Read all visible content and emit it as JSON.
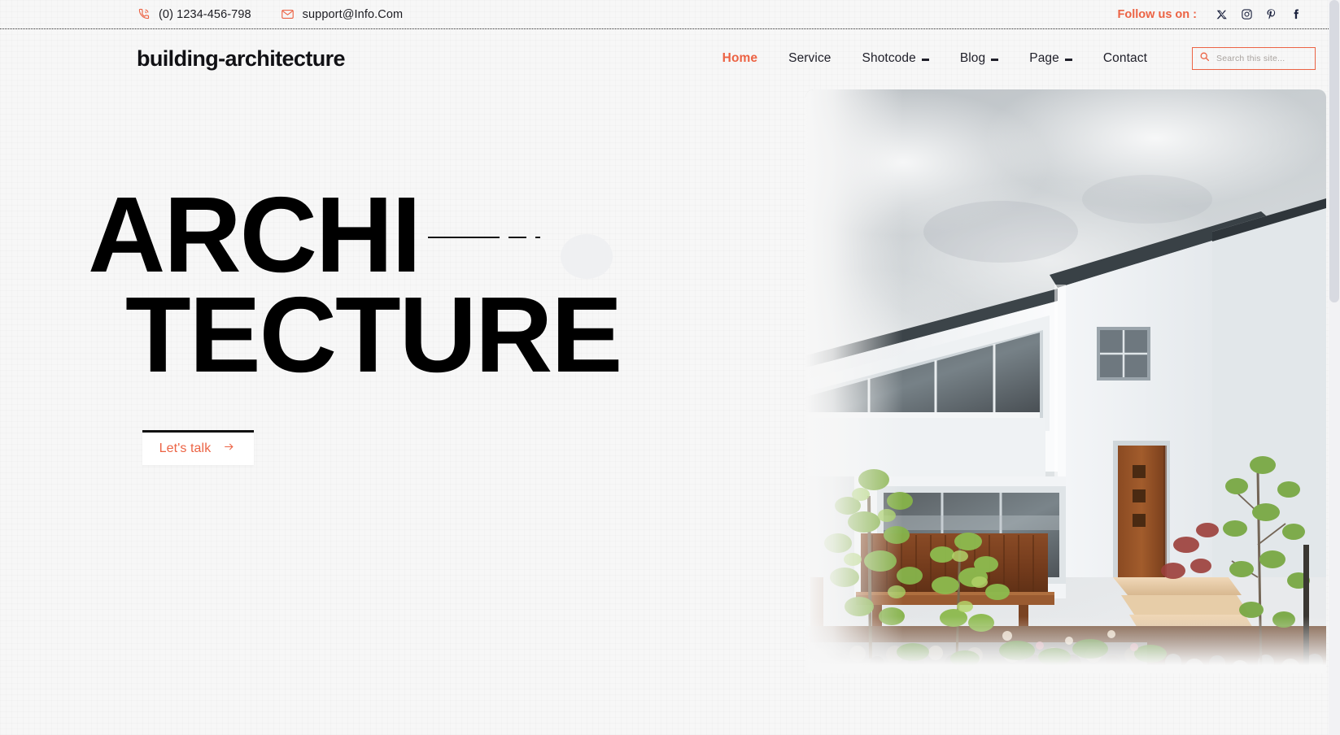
{
  "topbar": {
    "phone": {
      "icon": "phone-icon",
      "text": "(0) 1234-456-798"
    },
    "email": {
      "icon": "envelope-icon",
      "text": "support@Info.Com"
    },
    "follow_label": "Follow us on :",
    "socials": [
      {
        "name": "x-twitter-icon",
        "label": "X"
      },
      {
        "name": "instagram-icon",
        "label": "Instagram"
      },
      {
        "name": "pinterest-icon",
        "label": "Pinterest"
      },
      {
        "name": "facebook-icon",
        "label": "Facebook"
      }
    ]
  },
  "header": {
    "logo": "building-architecture",
    "nav": [
      {
        "label": "Home",
        "active": true,
        "has_dropdown": false
      },
      {
        "label": "Service",
        "active": false,
        "has_dropdown": false
      },
      {
        "label": "Shotcode",
        "active": false,
        "has_dropdown": true
      },
      {
        "label": "Blog",
        "active": false,
        "has_dropdown": true
      },
      {
        "label": "Page",
        "active": false,
        "has_dropdown": true
      },
      {
        "label": "Contact",
        "active": false,
        "has_dropdown": false
      }
    ],
    "search": {
      "icon": "search-icon",
      "placeholder": "Search this site...",
      "value": ""
    }
  },
  "hero": {
    "title_line_1": "ARCHI",
    "title_line_2": "TECTURE",
    "cta_label": "Let's talk",
    "cta_icon": "arrow-right-icon",
    "image_alt": "modern-white-house-with-garden"
  },
  "colors": {
    "accent": "#ec6344",
    "text_dark": "#111115",
    "nav_text": "#20202a",
    "social_icon": "#1d2440",
    "page_bg": "#f7f7f7",
    "deco_circle": "#eff0f2"
  }
}
